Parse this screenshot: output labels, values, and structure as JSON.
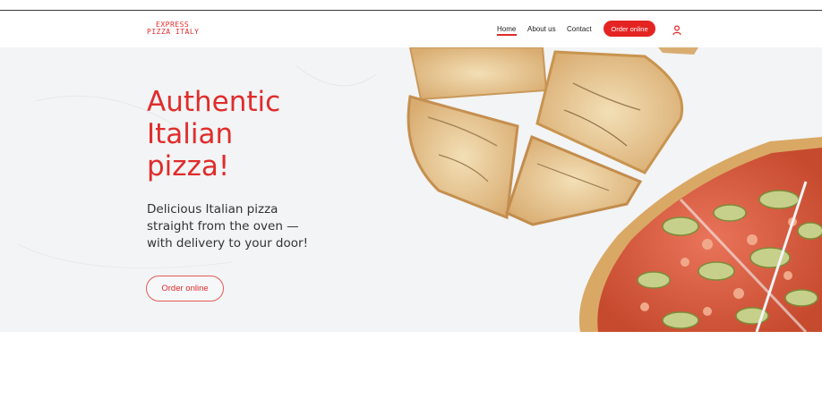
{
  "header": {
    "logo": {
      "line1": "EXPRESS",
      "line2": "PIZZA ITALY"
    },
    "nav": [
      {
        "label": "Home"
      },
      {
        "label": "About us"
      },
      {
        "label": "Contact"
      }
    ],
    "order_button": "Order online",
    "user_icon": "user-icon",
    "accent_color": "#e42423"
  },
  "hero": {
    "headline_lines": [
      "Authentic",
      "Italian",
      "pizza!"
    ],
    "subtitle_lines": [
      "Delicious Italian pizza",
      "straight from the oven —",
      "with delivery to your door!"
    ],
    "cta_button": "Order online",
    "image": "pizza-slices-image"
  }
}
